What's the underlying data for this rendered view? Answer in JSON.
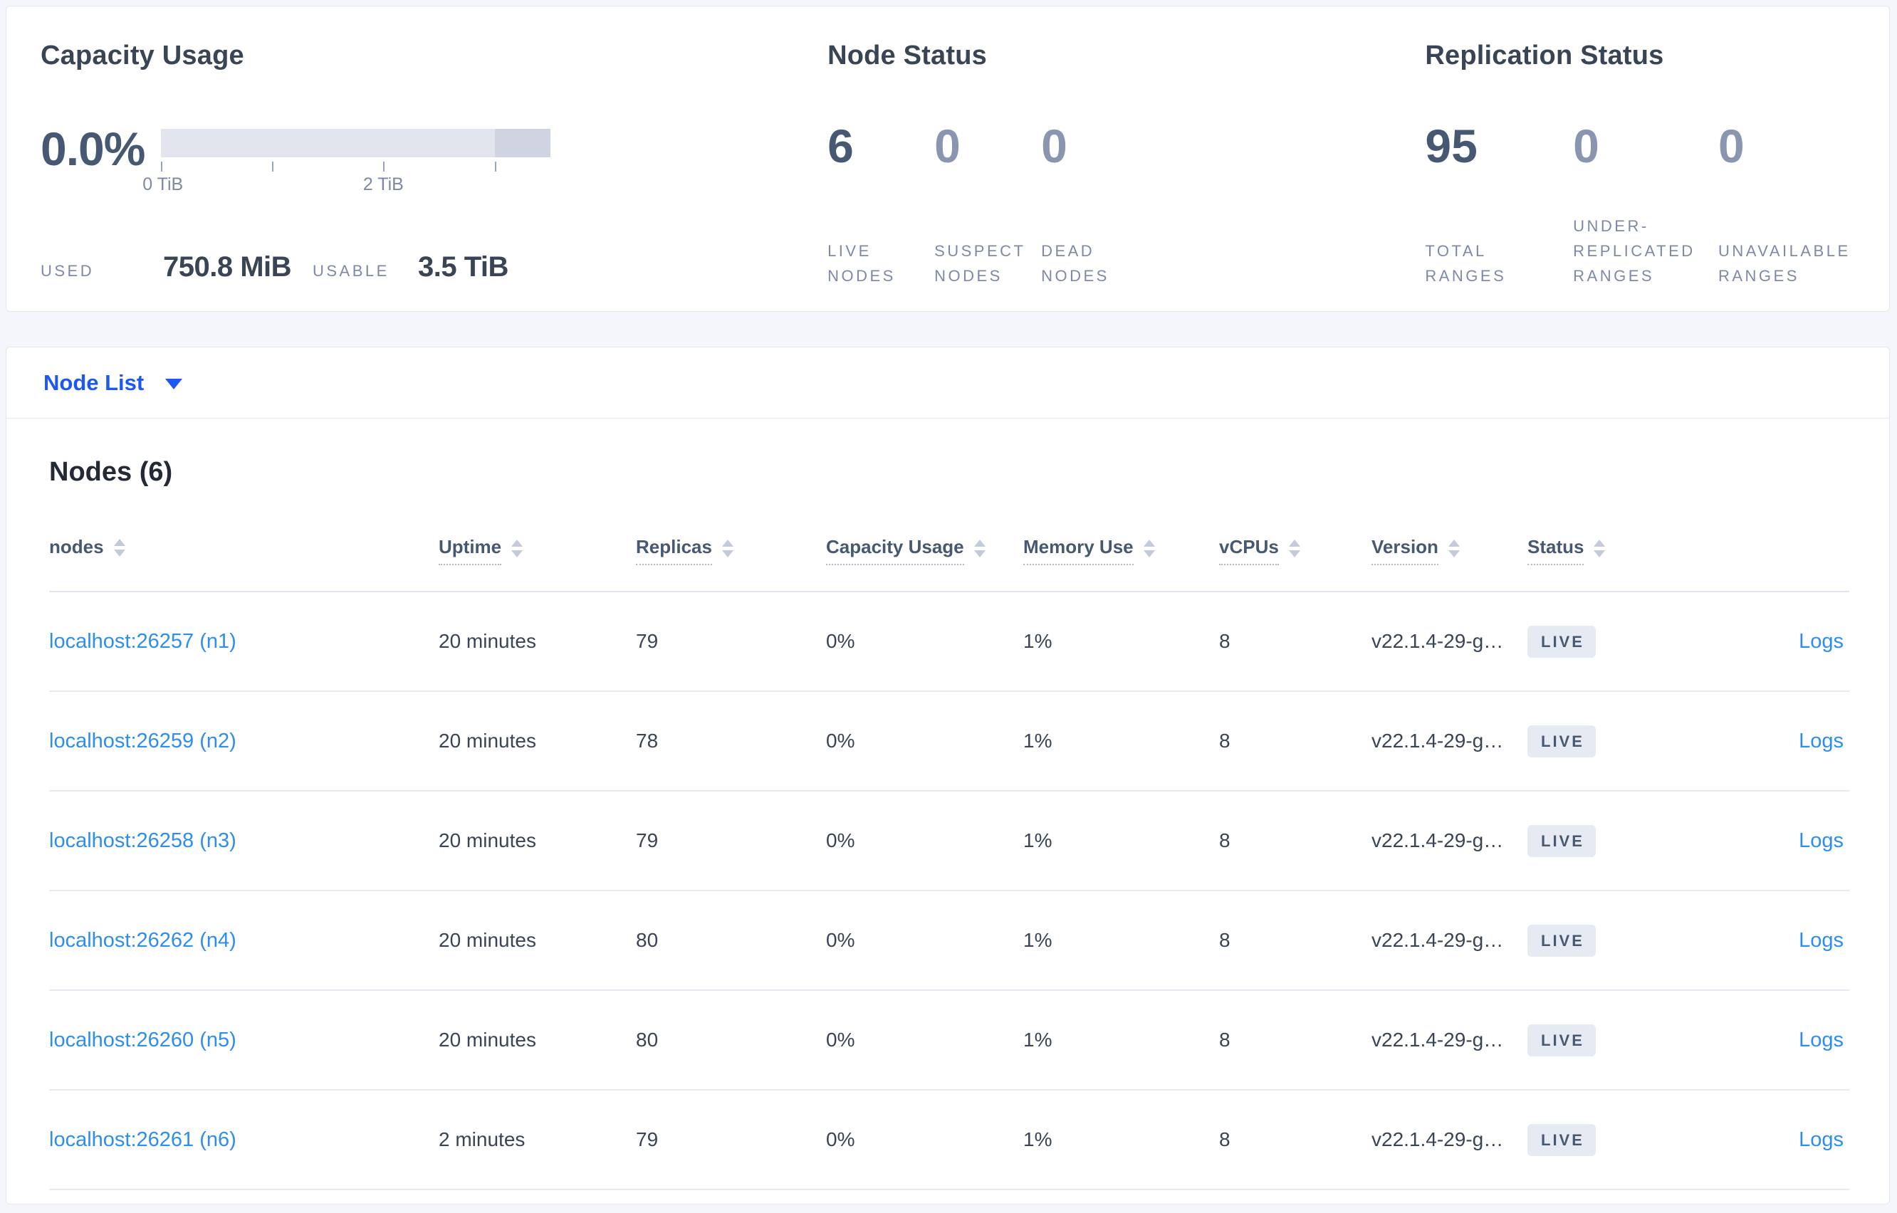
{
  "summary": {
    "capacity": {
      "title": "Capacity Usage",
      "percent": "0.0%",
      "tick_labels": [
        "0 TiB",
        "2 TiB"
      ],
      "used_label": "USED",
      "used_value": "750.8 MiB",
      "usable_label": "USABLE",
      "usable_value": "3.5 TiB"
    },
    "node_status": {
      "title": "Node Status",
      "items": [
        {
          "value": "6",
          "label": "LIVE NODES"
        },
        {
          "value": "0",
          "label": "SUSPECT NODES"
        },
        {
          "value": "0",
          "label": "DEAD NODES"
        }
      ]
    },
    "replication": {
      "title": "Replication Status",
      "items": [
        {
          "value": "95",
          "label": "TOTAL RANGES"
        },
        {
          "value": "0",
          "label": "UNDER-REPLICATED RANGES"
        },
        {
          "value": "0",
          "label": "UNAVAILABLE RANGES"
        }
      ]
    }
  },
  "view_selector": {
    "label": "Node List"
  },
  "table": {
    "title": "Nodes (6)",
    "columns": {
      "nodes": "nodes",
      "uptime": "Uptime",
      "replicas": "Replicas",
      "capacity": "Capacity Usage",
      "memory": "Memory Use",
      "vcpus": "vCPUs",
      "version": "Version",
      "status": "Status"
    },
    "rows": [
      {
        "node": "localhost:26257 (n1)",
        "uptime": "20 minutes",
        "replicas": "79",
        "capacity": "0%",
        "memory": "1%",
        "vcpus": "8",
        "version": "v22.1.4-29-g…",
        "status": "LIVE",
        "logs": "Logs"
      },
      {
        "node": "localhost:26259 (n2)",
        "uptime": "20 minutes",
        "replicas": "78",
        "capacity": "0%",
        "memory": "1%",
        "vcpus": "8",
        "version": "v22.1.4-29-g…",
        "status": "LIVE",
        "logs": "Logs"
      },
      {
        "node": "localhost:26258 (n3)",
        "uptime": "20 minutes",
        "replicas": "79",
        "capacity": "0%",
        "memory": "1%",
        "vcpus": "8",
        "version": "v22.1.4-29-g…",
        "status": "LIVE",
        "logs": "Logs"
      },
      {
        "node": "localhost:26262 (n4)",
        "uptime": "20 minutes",
        "replicas": "80",
        "capacity": "0%",
        "memory": "1%",
        "vcpus": "8",
        "version": "v22.1.4-29-g…",
        "status": "LIVE",
        "logs": "Logs"
      },
      {
        "node": "localhost:26260 (n5)",
        "uptime": "20 minutes",
        "replicas": "80",
        "capacity": "0%",
        "memory": "1%",
        "vcpus": "8",
        "version": "v22.1.4-29-g…",
        "status": "LIVE",
        "logs": "Logs"
      },
      {
        "node": "localhost:26261 (n6)",
        "uptime": "2 minutes",
        "replicas": "79",
        "capacity": "0%",
        "memory": "1%",
        "vcpus": "8",
        "version": "v22.1.4-29-g…",
        "status": "LIVE",
        "logs": "Logs"
      }
    ]
  },
  "colors": {
    "page_bg": "#f4f6fb",
    "card_bg": "#ffffff",
    "accent_blue": "#1d58f2",
    "link_blue": "#2d8ef0",
    "dark_text": "#394455",
    "stat_dark": "#475872",
    "muted_label": "#7e89a9",
    "muted_zero": "#8a96b0",
    "bar_light": "#e2e5ee",
    "bar_dark": "#cfd4e0",
    "badge_bg": "#e6eaf2"
  }
}
